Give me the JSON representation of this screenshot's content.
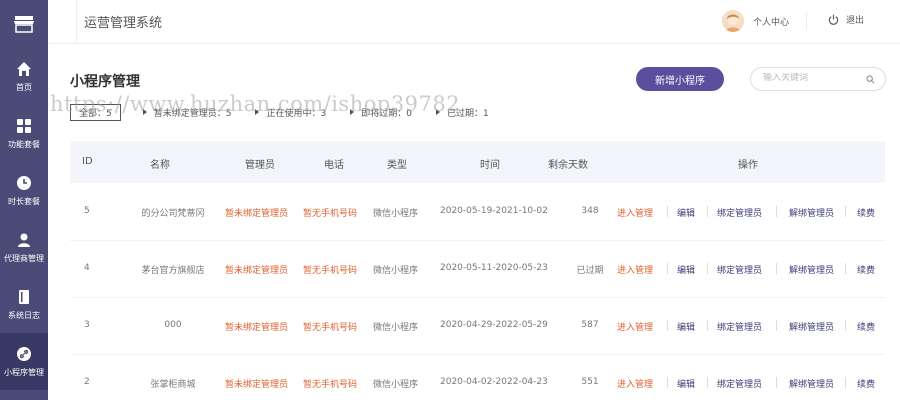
{
  "header": {
    "system_title": "运营管理系统",
    "user_center": "个人中心",
    "logout": "退出"
  },
  "sidebar": {
    "items": [
      {
        "label": "首页",
        "icon": "home-icon"
      },
      {
        "label": "功能套餐",
        "icon": "grid-icon"
      },
      {
        "label": "时长套餐",
        "icon": "clock-icon"
      },
      {
        "label": "代理商管理",
        "icon": "person-icon"
      },
      {
        "label": "系统日志",
        "icon": "book-icon"
      },
      {
        "label": "小程序管理",
        "icon": "link-icon",
        "active": true
      }
    ]
  },
  "main": {
    "page_title": "小程序管理",
    "add_button": "新增小程序",
    "search_placeholder": "输入关键词",
    "filters": [
      {
        "label": "全部：5"
      },
      {
        "label": "暂未绑定管理员：5"
      },
      {
        "label": "正在使用中：3"
      },
      {
        "label": "即将过期：0"
      },
      {
        "label": "已过期：1"
      }
    ],
    "watermark": "https://www.huzhan.com/ishop39782"
  },
  "table": {
    "headers": [
      "ID",
      "名称",
      "管理员",
      "电话",
      "类型",
      "时间",
      "剩余天数",
      "操作"
    ],
    "rows": [
      {
        "id": "5",
        "name": "的分公司梵蒂冈",
        "admin": "暂未绑定管理员",
        "phone": "暂无手机号码",
        "type": "微信小程序",
        "time": "2020-05-19-2021-10-02",
        "days": "348"
      },
      {
        "id": "4",
        "name": "茅台官方旗舰店",
        "admin": "暂未绑定管理员",
        "phone": "暂无手机号码",
        "type": "微信小程序",
        "time": "2020-05-11-2020-05-23",
        "days": "已过期"
      },
      {
        "id": "3",
        "name": "000",
        "admin": "暂未绑定管理员",
        "phone": "暂无手机号码",
        "type": "微信小程序",
        "time": "2020-04-29-2022-05-29",
        "days": "587"
      },
      {
        "id": "2",
        "name": "张掌柜商城",
        "admin": "暂未绑定管理员",
        "phone": "暂无手机号码",
        "type": "微信小程序",
        "time": "2020-04-02-2022-04-23",
        "days": "551"
      }
    ],
    "actions": [
      "进入管理",
      "编辑",
      "绑定管理员",
      "解绑管理员",
      "续费"
    ]
  },
  "colors": {
    "sidebar_bg": "#4b4b77",
    "accent": "#5a4f9f",
    "warn_red": "#e0612f",
    "action_blue": "#3c3c78"
  }
}
